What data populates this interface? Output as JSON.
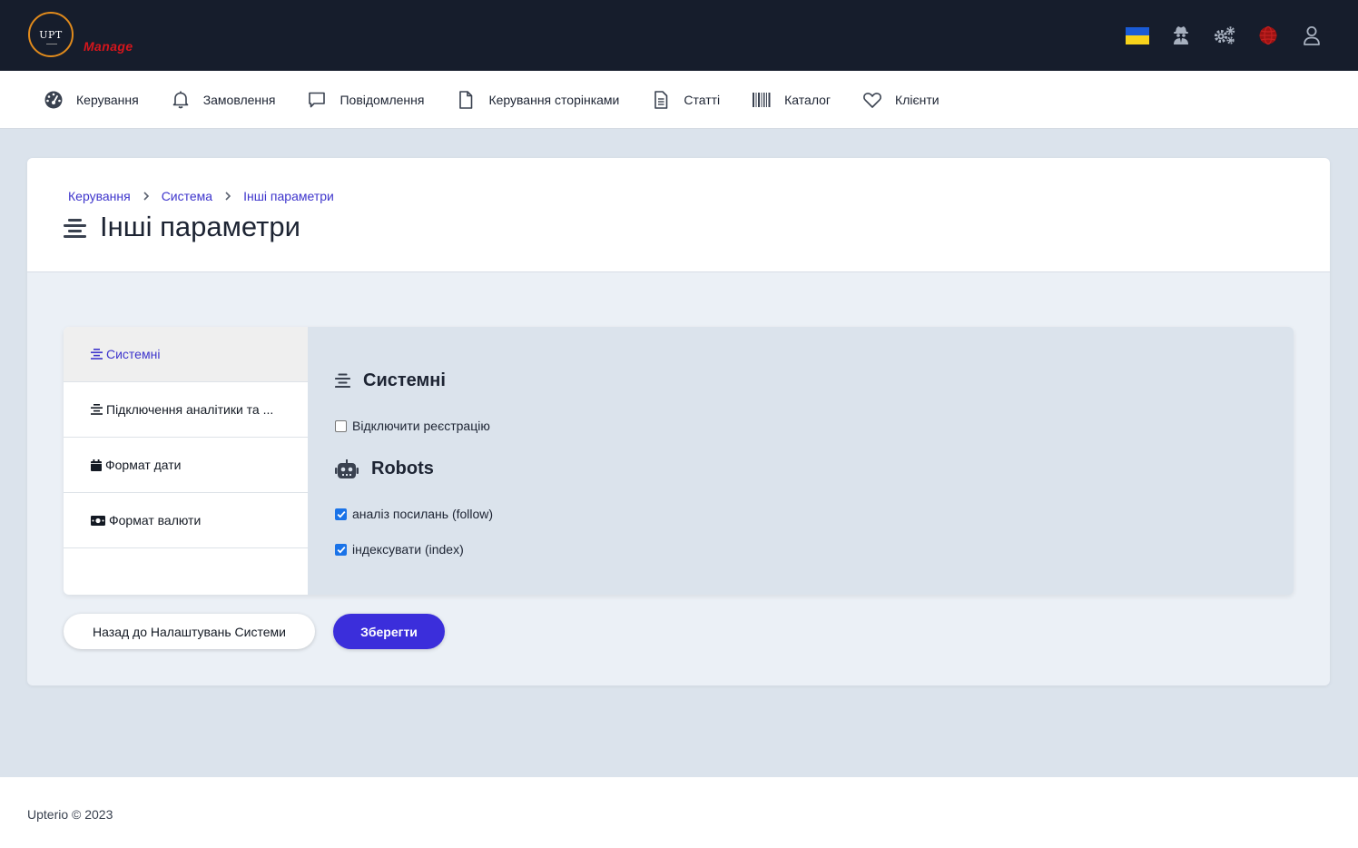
{
  "header": {
    "logo_text": "UPT",
    "brand": "Manage",
    "icons": [
      "ukraine-flag-icon",
      "user-secret-icon",
      "cogs-icon",
      "globe-icon",
      "user-icon"
    ],
    "colors": {
      "bar": "#161d2c",
      "brand": "#d4161c",
      "logo_ring": "#e08a1c"
    }
  },
  "nav": {
    "items": [
      {
        "label": "Керування",
        "icon": "dashboard-icon"
      },
      {
        "label": "Замовлення",
        "icon": "bell-icon"
      },
      {
        "label": "Повідомлення",
        "icon": "comment-icon"
      },
      {
        "label": "Керування сторінками",
        "icon": "file-icon"
      },
      {
        "label": "Статті",
        "icon": "file-lines-icon"
      },
      {
        "label": "Каталог",
        "icon": "barcode-icon"
      },
      {
        "label": "Клієнти",
        "icon": "heart-icon"
      }
    ]
  },
  "breadcrumb": [
    "Керування",
    "Система",
    "Інші параметри"
  ],
  "page": {
    "title": "Інші параметри",
    "title_icon": "align-center-icon"
  },
  "sidebar": {
    "items": [
      {
        "label": "Системні",
        "icon": "align-center-icon",
        "active": true
      },
      {
        "label": "Підключення аналітики та ...",
        "icon": "align-center-icon",
        "active": false
      },
      {
        "label": "Формат дати",
        "icon": "calendar-icon",
        "active": false
      },
      {
        "label": "Формат валюти",
        "icon": "money-bill-icon",
        "active": false
      }
    ]
  },
  "content": {
    "system": {
      "title": "Системні",
      "disable_registration": {
        "label": "Відключити реєстрацію",
        "checked": false
      }
    },
    "robots": {
      "title": "Robots",
      "follow": {
        "label": "аналіз посилань (follow)",
        "checked": true
      },
      "index": {
        "label": "індексувати (index)",
        "checked": true
      }
    }
  },
  "buttons": {
    "back": "Назад до Налаштувань Системи",
    "save": "Зберегти"
  },
  "footer": {
    "text": "Upterio © 2023"
  },
  "colors": {
    "accent": "#3b2edb",
    "link": "#3e35cc",
    "checkbox": "#1a73e8"
  }
}
